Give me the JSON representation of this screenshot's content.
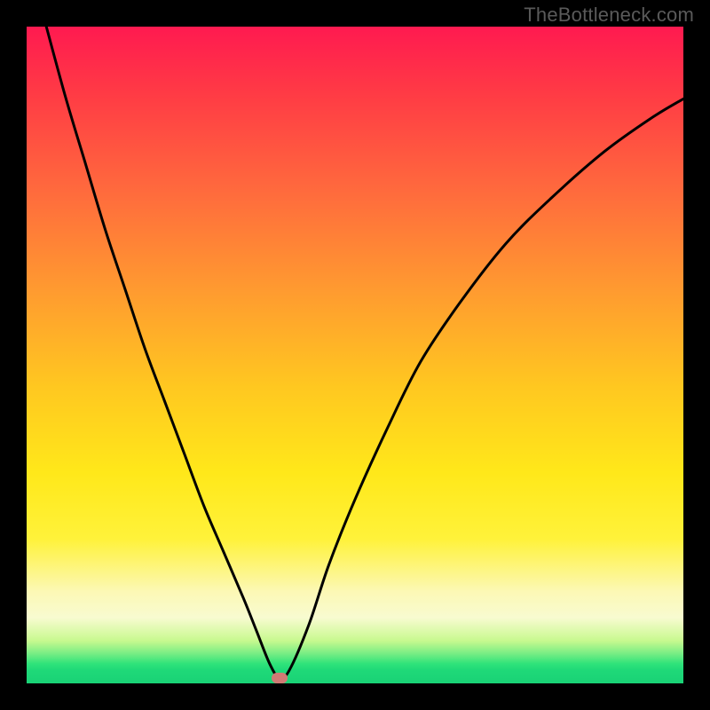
{
  "watermark": "TheBottleneck.com",
  "chart_data": {
    "type": "line",
    "title": "",
    "xlabel": "",
    "ylabel": "",
    "xlim": [
      0,
      100
    ],
    "ylim": [
      0,
      100
    ],
    "grid": false,
    "legend": false,
    "series": [
      {
        "name": "bottleneck-curve",
        "x": [
          3,
          6,
          9,
          12,
          15,
          18,
          21,
          24,
          27,
          30,
          33,
          35,
          37,
          38.5,
          40,
          43,
          46,
          50,
          55,
          60,
          66,
          73,
          80,
          88,
          95,
          100
        ],
        "values": [
          100,
          89,
          79,
          69,
          60,
          51,
          43,
          35,
          27,
          20,
          13,
          8,
          3,
          0.8,
          2,
          9,
          18,
          28,
          39,
          49,
          58,
          67,
          74,
          81,
          86,
          89
        ]
      }
    ],
    "minimum_point": {
      "x": 38.5,
      "y": 0.8
    },
    "marker_color": "#d17a74",
    "curve_color": "#000000",
    "background_gradient_stops": [
      {
        "pos": 0,
        "color": "#ff1a50"
      },
      {
        "pos": 0.55,
        "color": "#ffc820"
      },
      {
        "pos": 0.86,
        "color": "#fcf8b5"
      },
      {
        "pos": 0.97,
        "color": "#2fe37a"
      },
      {
        "pos": 1.0,
        "color": "#19d276"
      }
    ]
  }
}
